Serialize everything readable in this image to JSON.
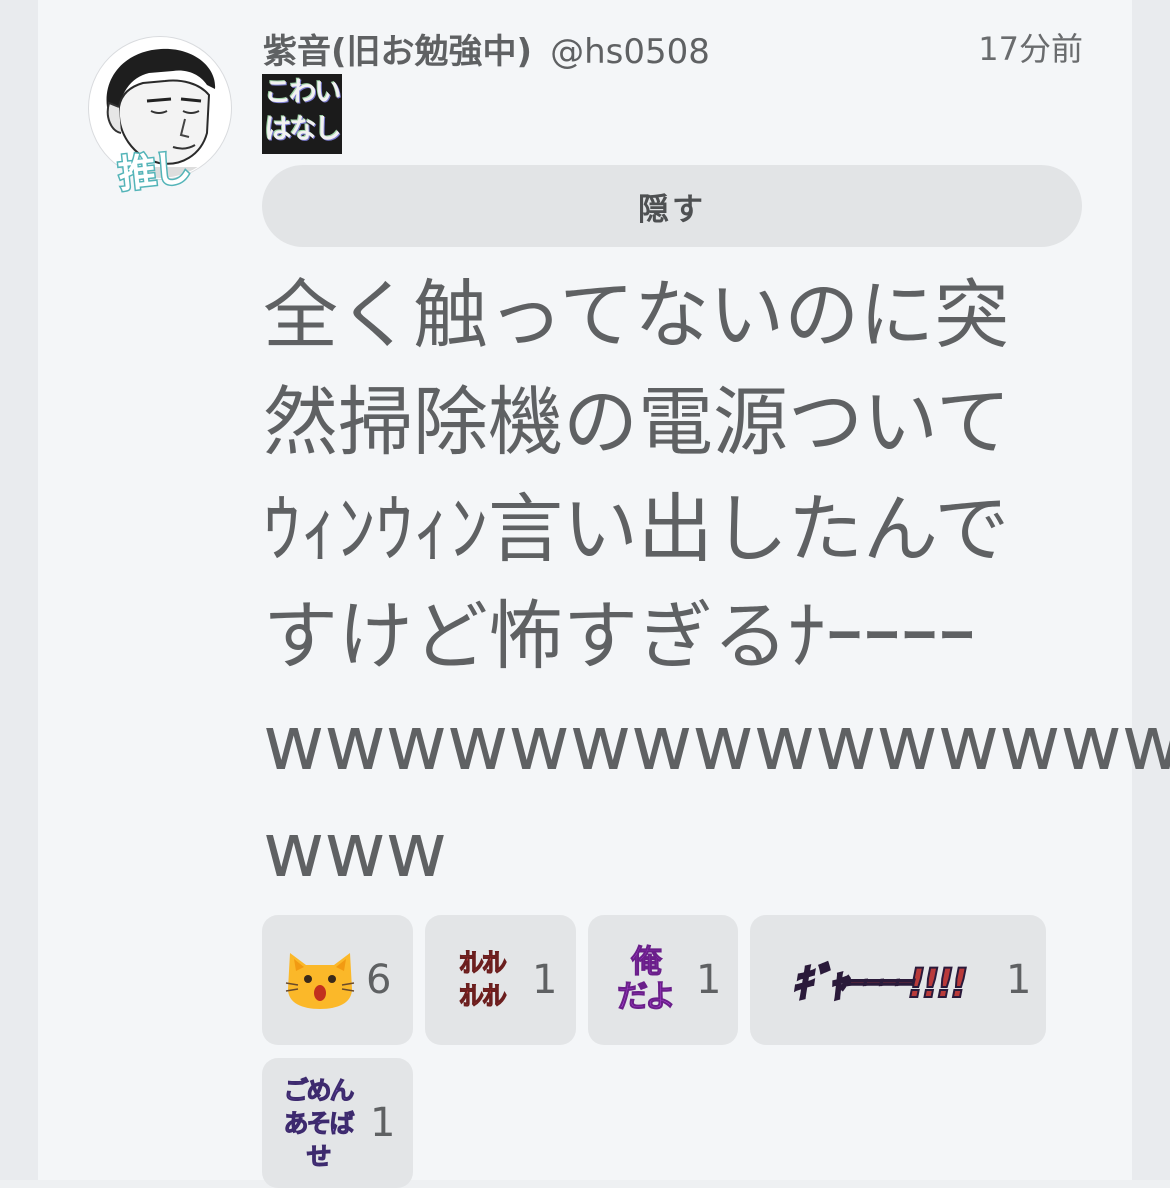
{
  "note": {
    "display_name": "紫音(旧お勉強中)",
    "username": "@hs0508",
    "time": "17分前",
    "avatar_badge": "推し",
    "cw_emoji": [
      "こわい",
      "はなし"
    ],
    "hide_button_label": "隠す",
    "body_lines": [
      "全く触ってないのに突",
      "然掃除機の電源ついて",
      "ｳｨﾝｳｨﾝ言い出したんで",
      "すけど怖すぎるﾅｰｰｰｰ",
      "wwwwwwwwwwwwwww",
      "www"
    ]
  },
  "reactions": [
    {
      "emoji": "cat-shocked-icon",
      "count": "6"
    },
    {
      "emoji_text": [
        "ｵﾚｵﾚ",
        "ｵﾚｵﾚ"
      ],
      "count": "1"
    },
    {
      "emoji_text": [
        "俺",
        "だよ"
      ],
      "count": "1"
    },
    {
      "emoji_text": [
        "ｷﾞｬｰｰｰｰ!!!!"
      ],
      "count": "1"
    },
    {
      "emoji_text": [
        "ごめん",
        "あそばせ"
      ],
      "count": "1"
    }
  ],
  "colors": {
    "background": "#eef0f2",
    "card": "#f4f6f8",
    "text": "#5f6163",
    "button": "#e2e4e6",
    "reaction_bg": "#e3e5e7",
    "badge_stroke": "#53b4b8"
  }
}
